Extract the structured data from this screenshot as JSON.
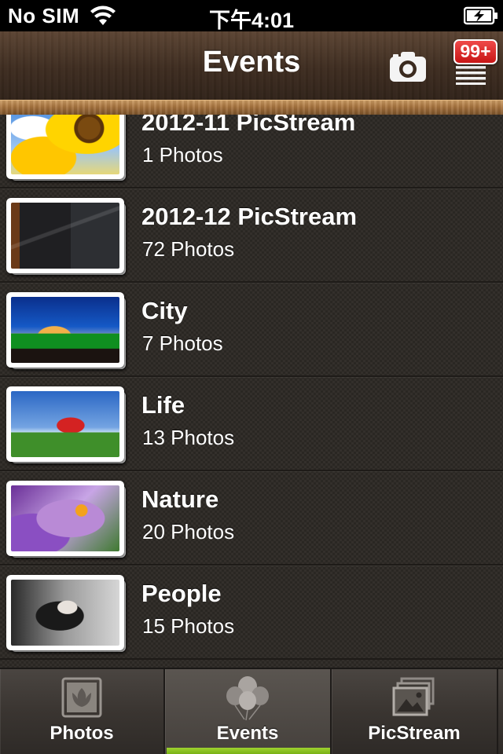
{
  "status_bar": {
    "carrier": "No SIM",
    "time": "下午4:01",
    "icons": [
      "wifi-icon",
      "battery-charging-icon"
    ]
  },
  "nav_bar": {
    "title": "Events",
    "badge": "99+",
    "icons": [
      "camera-icon",
      "menu-icon"
    ]
  },
  "events": [
    {
      "title": "2012-11 PicStream",
      "count": "1 Photos",
      "thumbnail": "sunflower"
    },
    {
      "title": "2012-12 PicStream",
      "count": "72 Photos",
      "thumbnail": "dark-interior"
    },
    {
      "title": "City",
      "count": "7 Photos",
      "thumbnail": "city-bridge-night"
    },
    {
      "title": "Life",
      "count": "13 Photos",
      "thumbnail": "red-helicopter"
    },
    {
      "title": "Nature",
      "count": "20 Photos",
      "thumbnail": "purple-flower"
    },
    {
      "title": "People",
      "count": "15 Photos",
      "thumbnail": "portrait-bw"
    }
  ],
  "tab_bar": {
    "tabs": [
      {
        "label": "Photos",
        "icon": "photos-tab-icon",
        "active": false
      },
      {
        "label": "Events",
        "icon": "balloons-icon",
        "active": true
      },
      {
        "label": "PicStream",
        "icon": "picstream-icon",
        "active": false
      }
    ],
    "active_color": "#8cc41f"
  }
}
